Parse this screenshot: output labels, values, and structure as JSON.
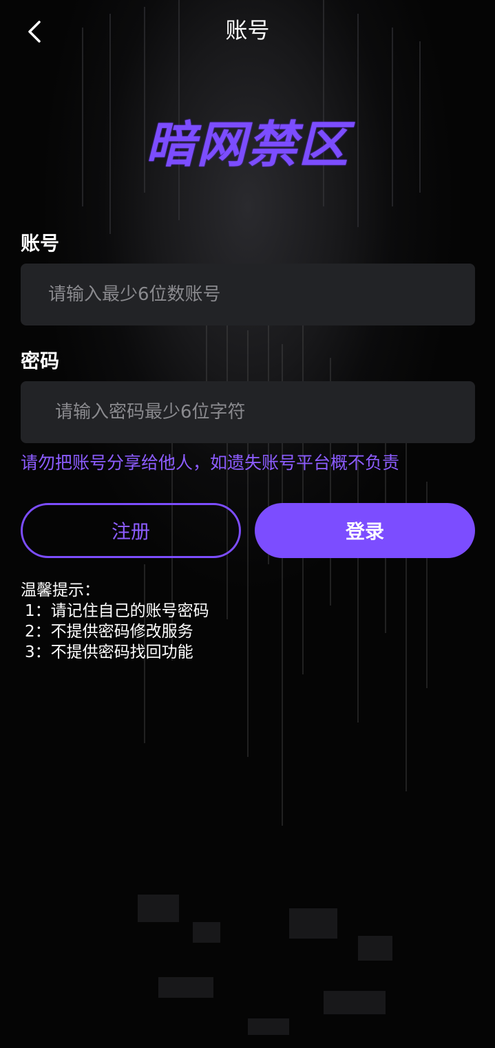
{
  "header": {
    "title": "账号"
  },
  "logo": {
    "text": "暗网禁区"
  },
  "form": {
    "account_label": "账号",
    "account_placeholder": "请输入最少6位数账号",
    "password_label": "密码",
    "password_placeholder": "请输入密码最少6位字符",
    "warning": "请勿把账号分享给他人，如遗失账号平台概不负责"
  },
  "buttons": {
    "register_label": "注册",
    "login_label": "登录"
  },
  "tips": {
    "title": "温馨提示：",
    "items": [
      "1：请记住自己的账号密码",
      "2：不提供密码修改服务",
      "3：不提供密码找回功能"
    ]
  },
  "colors": {
    "accent": "#7c4dff",
    "input_bg": "#222326",
    "background": "#000000"
  },
  "icons": {
    "back": "chevron-left-icon"
  }
}
